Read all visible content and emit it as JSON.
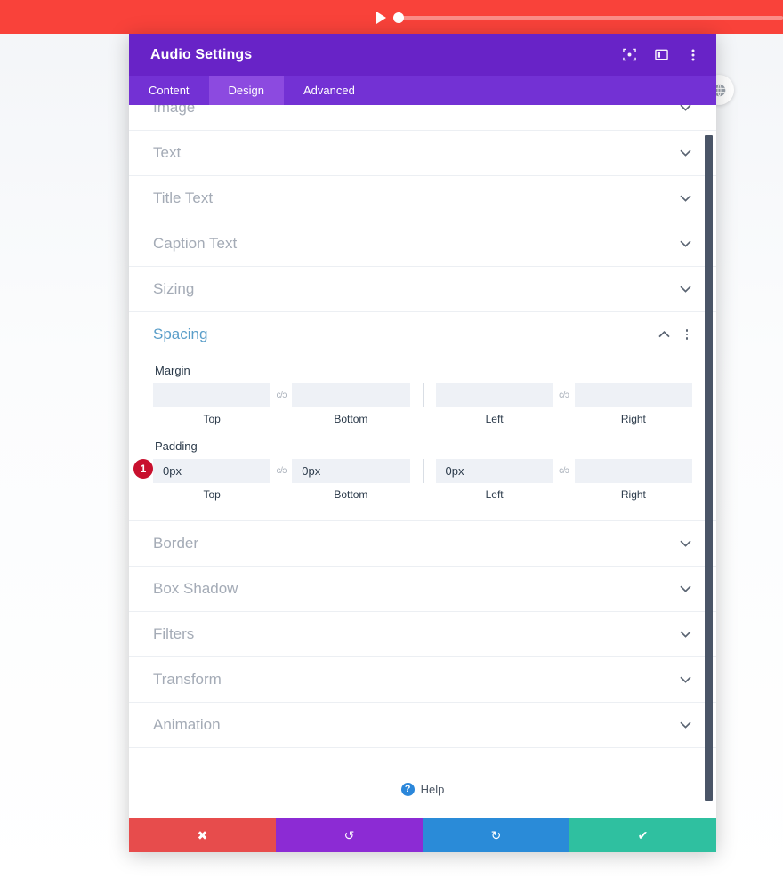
{
  "audio_player": {
    "play_icon": "play-triangle-icon",
    "progress_handle": "progress-handle",
    "accent_color": "#f9423a",
    "track_color": "#fb8d88"
  },
  "globe_button": {
    "icon": "globe-icon"
  },
  "modal": {
    "title": "Audio Settings",
    "header_color": "#6823c7",
    "header_icons": [
      {
        "name": "focus-target-icon",
        "label": "Focus"
      },
      {
        "name": "layout-panel-icon",
        "label": "Layout"
      },
      {
        "name": "more-vertical-icon",
        "label": "More options"
      }
    ],
    "tabs": [
      {
        "label": "Content",
        "active": false
      },
      {
        "label": "Design",
        "active": true
      },
      {
        "label": "Advanced",
        "active": false
      }
    ],
    "sections_above": [
      {
        "label": "Image",
        "expanded": false
      },
      {
        "label": "Text",
        "expanded": false
      },
      {
        "label": "Title Text",
        "expanded": false
      },
      {
        "label": "Caption Text",
        "expanded": false
      },
      {
        "label": "Sizing",
        "expanded": false
      }
    ],
    "spacing_section": {
      "label": "Spacing",
      "expanded": true,
      "accent_color": "#5a9ec9",
      "margin": {
        "label": "Margin",
        "fields": [
          {
            "caption": "Top",
            "value": "",
            "placeholder": ""
          },
          {
            "caption": "Bottom",
            "value": "",
            "placeholder": ""
          },
          {
            "caption": "Left",
            "value": "",
            "placeholder": ""
          },
          {
            "caption": "Right",
            "value": "",
            "placeholder": ""
          }
        ]
      },
      "padding": {
        "label": "Padding",
        "badge": "1",
        "badge_color": "#c8102e",
        "fields": [
          {
            "caption": "Top",
            "value": "0px",
            "placeholder": ""
          },
          {
            "caption": "Bottom",
            "value": "0px",
            "placeholder": ""
          },
          {
            "caption": "Left",
            "value": "0px",
            "placeholder": ""
          },
          {
            "caption": "Right",
            "value": "",
            "placeholder": ""
          }
        ]
      },
      "link_icon": "c/ɔ"
    },
    "sections_below": [
      {
        "label": "Border",
        "expanded": false
      },
      {
        "label": "Box Shadow",
        "expanded": false
      },
      {
        "label": "Filters",
        "expanded": false
      },
      {
        "label": "Transform",
        "expanded": false
      },
      {
        "label": "Animation",
        "expanded": false
      }
    ],
    "help": {
      "label": "Help",
      "icon": "question-mark-icon",
      "icon_color": "#2b87da"
    },
    "footer_buttons": [
      {
        "name": "cancel-button",
        "glyph": "✖",
        "color": "#e74c4c"
      },
      {
        "name": "undo-button",
        "glyph": "↺",
        "color": "#8c2bd4"
      },
      {
        "name": "redo-button",
        "glyph": "↻",
        "color": "#2a8bd8"
      },
      {
        "name": "save-button",
        "glyph": "✔",
        "color": "#2fc0a0"
      }
    ]
  }
}
